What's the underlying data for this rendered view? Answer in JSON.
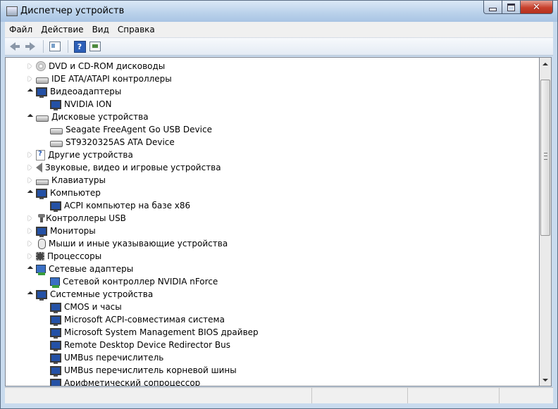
{
  "window": {
    "title": "Диспетчер устройств",
    "close_glyph": "✕"
  },
  "menu": [
    {
      "label": "Файл",
      "name": "menu-file"
    },
    {
      "label": "Действие",
      "name": "menu-action"
    },
    {
      "label": "Вид",
      "name": "menu-view"
    },
    {
      "label": "Справка",
      "name": "menu-help"
    }
  ],
  "toolbar": {
    "help_glyph": "?"
  },
  "tree": [
    {
      "label": "DVD и CD-ROM дисководы",
      "level": 0,
      "state": "collapsed",
      "icon": "disc-icon"
    },
    {
      "label": "IDE ATA/ATAPI контроллеры",
      "level": 0,
      "state": "collapsed",
      "icon": "ide-controller-icon"
    },
    {
      "label": "Видеоадаптеры",
      "level": 0,
      "state": "expanded",
      "icon": "display-adapter-icon"
    },
    {
      "label": "NVIDIA ION",
      "level": 1,
      "state": "none",
      "icon": "display-adapter-icon"
    },
    {
      "label": "Дисковые устройства",
      "level": 0,
      "state": "expanded",
      "icon": "disk-drive-icon"
    },
    {
      "label": "Seagate FreeAgent Go USB Device",
      "level": 1,
      "state": "none",
      "icon": "disk-drive-icon"
    },
    {
      "label": "ST9320325AS ATA Device",
      "level": 1,
      "state": "none",
      "icon": "disk-drive-icon"
    },
    {
      "label": "Другие устройства",
      "level": 0,
      "state": "collapsed",
      "icon": "other-devices-icon"
    },
    {
      "label": "Звуковые, видео и игровые устройства",
      "level": 0,
      "state": "collapsed",
      "icon": "speaker-icon"
    },
    {
      "label": "Клавиатуры",
      "level": 0,
      "state": "collapsed",
      "icon": "keyboard-icon"
    },
    {
      "label": "Компьютер",
      "level": 0,
      "state": "expanded",
      "icon": "computer-icon"
    },
    {
      "label": "ACPI компьютер на базе x86",
      "level": 1,
      "state": "none",
      "icon": "computer-icon"
    },
    {
      "label": "Контроллеры USB",
      "level": 0,
      "state": "collapsed",
      "icon": "usb-icon"
    },
    {
      "label": "Мониторы",
      "level": 0,
      "state": "collapsed",
      "icon": "monitor-icon"
    },
    {
      "label": "Мыши и иные указывающие устройства",
      "level": 0,
      "state": "collapsed",
      "icon": "mouse-icon"
    },
    {
      "label": "Процессоры",
      "level": 0,
      "state": "collapsed",
      "icon": "processor-icon"
    },
    {
      "label": "Сетевые адаптеры",
      "level": 0,
      "state": "expanded",
      "icon": "network-adapter-icon"
    },
    {
      "label": "Сетевой контроллер NVIDIA nForce",
      "level": 1,
      "state": "none",
      "icon": "network-adapter-icon"
    },
    {
      "label": "Системные устройства",
      "level": 0,
      "state": "expanded",
      "icon": "system-device-icon"
    },
    {
      "label": "CMOS и часы",
      "level": 1,
      "state": "none",
      "icon": "system-device-icon"
    },
    {
      "label": "Microsoft ACPI-совместимая система",
      "level": 1,
      "state": "none",
      "icon": "system-device-icon"
    },
    {
      "label": "Microsoft System Management BIOS драйвер",
      "level": 1,
      "state": "none",
      "icon": "system-device-icon"
    },
    {
      "label": "Remote Desktop Device Redirector Bus",
      "level": 1,
      "state": "none",
      "icon": "system-device-icon"
    },
    {
      "label": "UMBus перечислитель",
      "level": 1,
      "state": "none",
      "icon": "system-device-icon"
    },
    {
      "label": "UMBus перечислитель корневой шины",
      "level": 1,
      "state": "none",
      "icon": "system-device-icon"
    },
    {
      "label": "Арифметический сопроцессор",
      "level": 1,
      "state": "none",
      "icon": "system-device-icon"
    }
  ]
}
